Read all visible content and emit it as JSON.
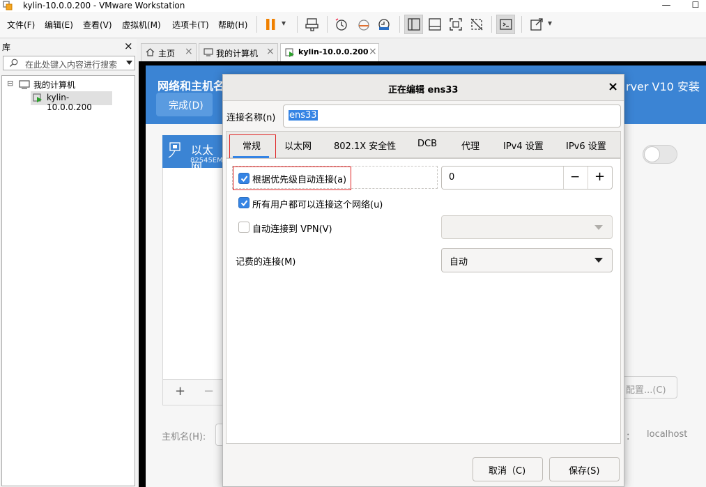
{
  "window": {
    "title": "kylin-10.0.0.200 - VMware Workstation",
    "minimize_glyph": "—",
    "maximize_glyph": "☐"
  },
  "menu": [
    "文件(F)",
    "编辑(E)",
    "查看(V)",
    "虚拟机(M)",
    "选项卡(T)",
    "帮助(H)"
  ],
  "toolbar": {
    "dropdown_glyph": "▾"
  },
  "library": {
    "title": "库",
    "close_glyph": "×",
    "search_placeholder": "在此处键入内容进行搜索",
    "tree": {
      "expander": "⊟",
      "root": "我的计算机",
      "child": "kylin-10.0.0.200"
    }
  },
  "tabs": [
    {
      "label": "主页"
    },
    {
      "label": "我的计算机"
    },
    {
      "label": "kylin-10.0.0.200"
    }
  ],
  "tab_close_glyph": "×",
  "guest": {
    "header_title": "网络和主机名",
    "header_right": "rver V10 安装",
    "done_button": "完成(D)",
    "ethernet_label": "以太网",
    "ethernet_sub": "82545EM",
    "add_glyph": "+",
    "remove_glyph": "−",
    "configure_button": "配置...(C)",
    "hostname_label": "主机名(H):",
    "hostname_colon": "：",
    "current_hostname": "localhost"
  },
  "dialog": {
    "title": "正在编辑 ens33",
    "close_glyph": "×",
    "conn_name_label": "连接名称(n)",
    "conn_name_value": "ens33",
    "tabs": [
      "常规",
      "以太网",
      "802.1X 安全性",
      "DCB",
      "代理",
      "IPv4 设置",
      "IPv6 设置"
    ],
    "active_tab": "常规",
    "auto_priority_label": "根据优先级自动连接(a)",
    "auto_priority_checked": true,
    "priority_value": "0",
    "minus_glyph": "−",
    "plus_glyph": "+",
    "all_users_label": "所有用户都可以连接这个网络(u)",
    "all_users_checked": true,
    "vpn_label": "自动连接到 VPN(V)",
    "vpn_checked": false,
    "vpn_select_value": "",
    "metered_label": "记费的连接(M)",
    "metered_value": "自动",
    "cancel_button": "取消（C)",
    "save_button": "保存(S)"
  },
  "colors": {
    "guest_blue": "#3b84d4",
    "gtk_accent": "#3584e4",
    "highlight_red": "#e02020",
    "pause_orange": "#f08000"
  }
}
